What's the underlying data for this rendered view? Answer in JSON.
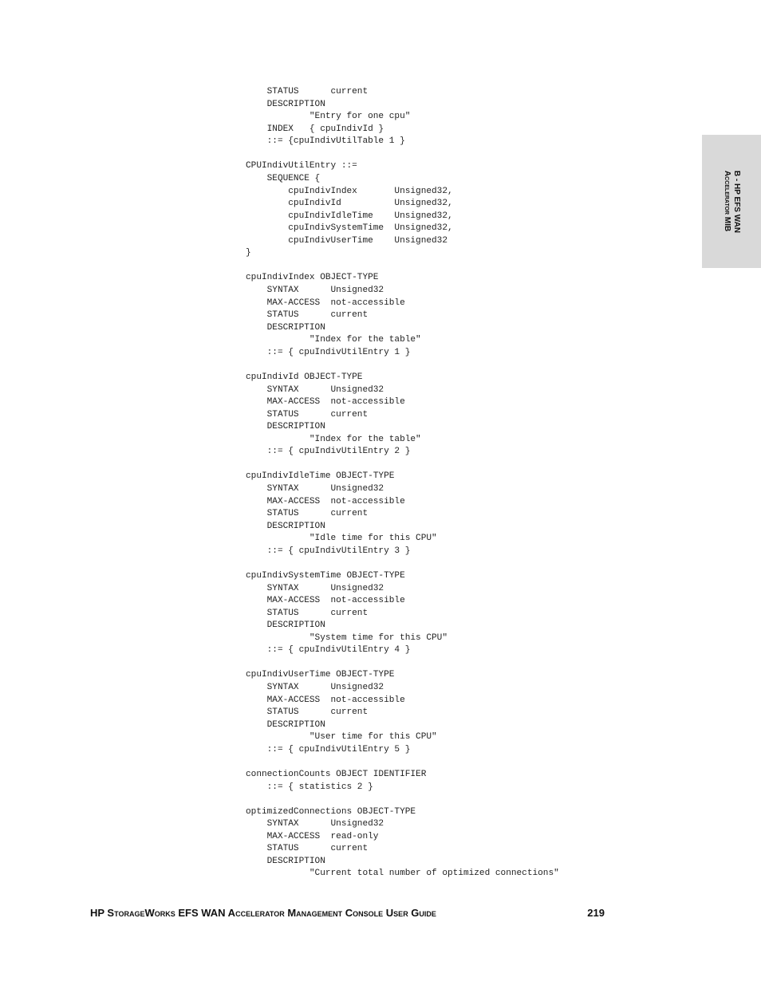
{
  "code_lines": [
    "    STATUS      current",
    "    DESCRIPTION",
    "            \"Entry for one cpu\"",
    "    INDEX   { cpuIndivId }",
    "    ::= {cpuIndivUtilTable 1 }",
    "",
    "CPUIndivUtilEntry ::=",
    "    SEQUENCE {",
    "        cpuIndivIndex       Unsigned32,",
    "        cpuIndivId          Unsigned32,",
    "        cpuIndivIdleTime    Unsigned32,",
    "        cpuIndivSystemTime  Unsigned32,",
    "        cpuIndivUserTime    Unsigned32",
    "}",
    "",
    "cpuIndivIndex OBJECT-TYPE",
    "    SYNTAX      Unsigned32",
    "    MAX-ACCESS  not-accessible",
    "    STATUS      current",
    "    DESCRIPTION",
    "            \"Index for the table\"",
    "    ::= { cpuIndivUtilEntry 1 }",
    "",
    "cpuIndivId OBJECT-TYPE",
    "    SYNTAX      Unsigned32",
    "    MAX-ACCESS  not-accessible",
    "    STATUS      current",
    "    DESCRIPTION",
    "            \"Index for the table\"",
    "    ::= { cpuIndivUtilEntry 2 }",
    "",
    "cpuIndivIdleTime OBJECT-TYPE",
    "    SYNTAX      Unsigned32",
    "    MAX-ACCESS  not-accessible",
    "    STATUS      current",
    "    DESCRIPTION",
    "            \"Idle time for this CPU\"",
    "    ::= { cpuIndivUtilEntry 3 }",
    "",
    "cpuIndivSystemTime OBJECT-TYPE",
    "    SYNTAX      Unsigned32",
    "    MAX-ACCESS  not-accessible",
    "    STATUS      current",
    "    DESCRIPTION",
    "            \"System time for this CPU\"",
    "    ::= { cpuIndivUtilEntry 4 }",
    "",
    "cpuIndivUserTime OBJECT-TYPE",
    "    SYNTAX      Unsigned32",
    "    MAX-ACCESS  not-accessible",
    "    STATUS      current",
    "    DESCRIPTION",
    "            \"User time for this CPU\"",
    "    ::= { cpuIndivUtilEntry 5 }",
    "",
    "connectionCounts OBJECT IDENTIFIER",
    "    ::= { statistics 2 }",
    "",
    "optimizedConnections OBJECT-TYPE",
    "    SYNTAX      Unsigned32",
    "    MAX-ACCESS  read-only",
    "    STATUS      current",
    "    DESCRIPTION",
    "            \"Current total number of optimized connections\""
  ],
  "side_tab": {
    "line1": "B - HP EFS WAN",
    "line2": "Accelerator MIB"
  },
  "footer": {
    "title": "HP StorageWorks EFS WAN Accelerator Management Console User Guide",
    "page_number": "219"
  }
}
